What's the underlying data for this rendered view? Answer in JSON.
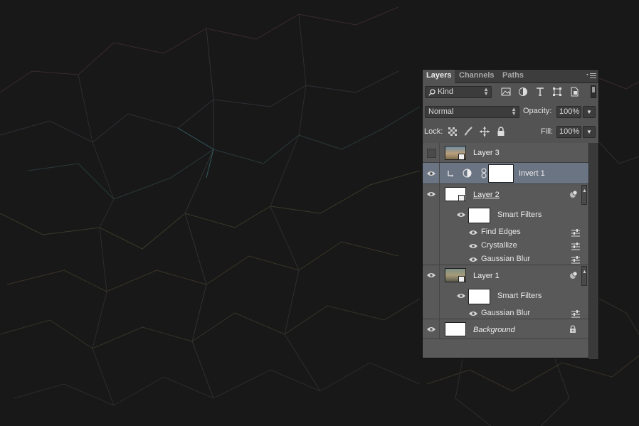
{
  "panel": {
    "tabs": [
      {
        "label": "Layers",
        "active": true
      },
      {
        "label": "Channels",
        "active": false
      },
      {
        "label": "Paths",
        "active": false
      }
    ],
    "filter_kind": "Kind",
    "blend_mode": "Normal",
    "opacity_label": "Opacity:",
    "opacity_value": "100%",
    "lock_label": "Lock:",
    "fill_label": "Fill:",
    "fill_value": "100%"
  },
  "layers": [
    {
      "name": "Layer 3",
      "visible": false,
      "kind": "smart-object"
    },
    {
      "name": "Invert 1",
      "visible": true,
      "kind": "adjustment",
      "selected": true
    },
    {
      "name": "Layer 2",
      "visible": true,
      "kind": "smart-object",
      "smart_filters_label": "Smart Filters",
      "filters": [
        "Find Edges",
        "Crystallize",
        "Gaussian Blur"
      ]
    },
    {
      "name": "Layer 1",
      "visible": true,
      "kind": "smart-object",
      "smart_filters_label": "Smart Filters",
      "filters": [
        "Gaussian Blur"
      ]
    },
    {
      "name": "Background",
      "visible": true,
      "kind": "background",
      "locked": true
    }
  ],
  "colors": {
    "canvas": "#181818",
    "panel": "#535353",
    "selected_row": "#6b7482"
  }
}
